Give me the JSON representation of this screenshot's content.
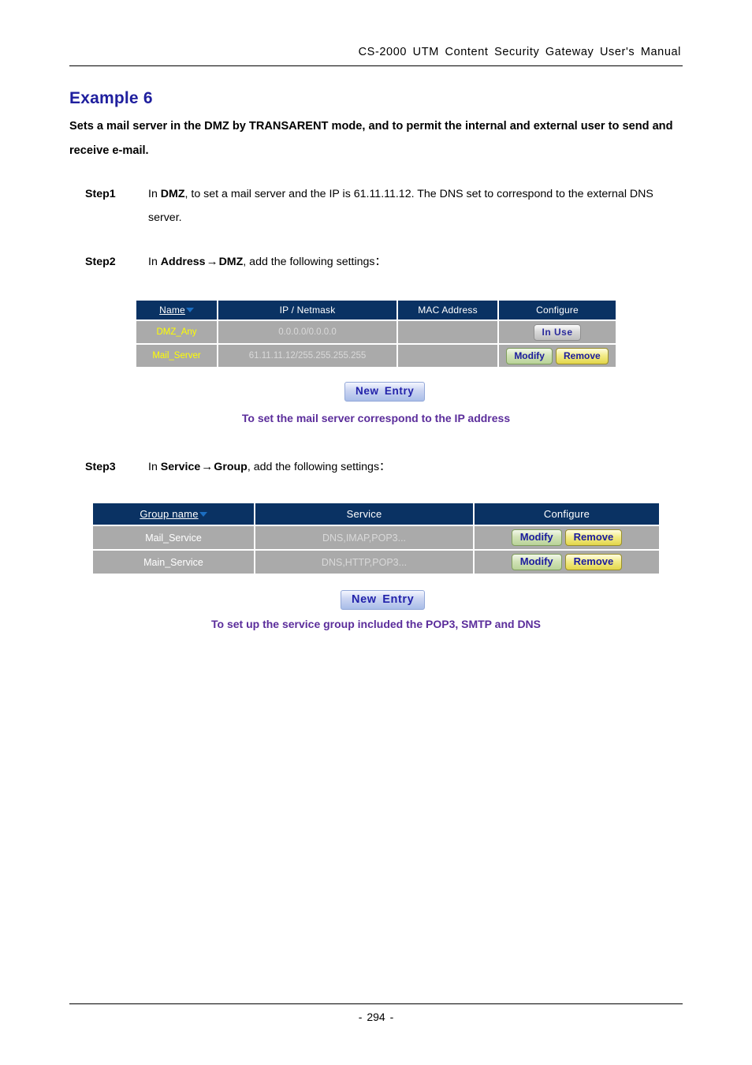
{
  "header": {
    "manual_title": "CS-2000  UTM  Content  Security  Gateway  User's  Manual"
  },
  "title": {
    "heading": "Example 6",
    "description": "Sets a mail server in the DMZ by TRANSARENT mode, and to permit the internal and external user to send and receive e-mail."
  },
  "steps": [
    {
      "label": "Step1",
      "prefix": "In ",
      "bold1": "DMZ",
      "text": ", to set a mail server and the IP is 61.11.11.12. The DNS set to correspond to the external DNS server."
    },
    {
      "label": "Step2",
      "prefix": "In ",
      "bold1": "Address",
      "arrow": "→",
      "bold2": "DMZ",
      "text": ", add the following settings："
    },
    {
      "label": "Step3",
      "prefix": "In ",
      "bold1": "Service",
      "arrow": "→",
      "bold2": "Group",
      "text": ", add the following settings："
    }
  ],
  "address_table": {
    "columns": [
      "Name",
      "IP / Netmask",
      "MAC Address",
      "Configure"
    ],
    "sort_column": "Name",
    "rows": [
      {
        "name": "DMZ_Any",
        "ip_netmask": "0.0.0.0/0.0.0.0",
        "mac_address": "",
        "buttons": [
          {
            "label": "In  Use",
            "style": "inuse"
          }
        ]
      },
      {
        "name": "Mail_Server",
        "ip_netmask": "61.11.11.12/255.255.255.255",
        "mac_address": "",
        "buttons": [
          {
            "label": "Modify",
            "style": "modify"
          },
          {
            "label": "Remove",
            "style": "remove"
          }
        ]
      }
    ],
    "new_entry_label": "New  Entry",
    "caption": "To set the mail server correspond to the IP address"
  },
  "service_table": {
    "columns": [
      "Group name",
      "Service",
      "Configure"
    ],
    "sort_column": "Group name",
    "rows": [
      {
        "group_name": "Mail_Service",
        "service": "DNS,IMAP,POP3...",
        "buttons": [
          {
            "label": "Modify",
            "style": "modify"
          },
          {
            "label": "Remove",
            "style": "remove"
          }
        ]
      },
      {
        "group_name": "Main_Service",
        "service": "DNS,HTTP,POP3...",
        "buttons": [
          {
            "label": "Modify",
            "style": "modify"
          },
          {
            "label": "Remove",
            "style": "remove"
          }
        ]
      }
    ],
    "new_entry_label": "New  Entry",
    "caption": "To set up the service group included the POP3, SMTP and DNS"
  },
  "footer": {
    "page_number": "- 294 -"
  },
  "colors": {
    "heading_blue": "#1f1f9e",
    "table_header_navy": "#0a3263",
    "table_row_gray": "#aaaaaa",
    "name_yellow": "#ffff00",
    "caption_purple": "#5b2d9b"
  }
}
